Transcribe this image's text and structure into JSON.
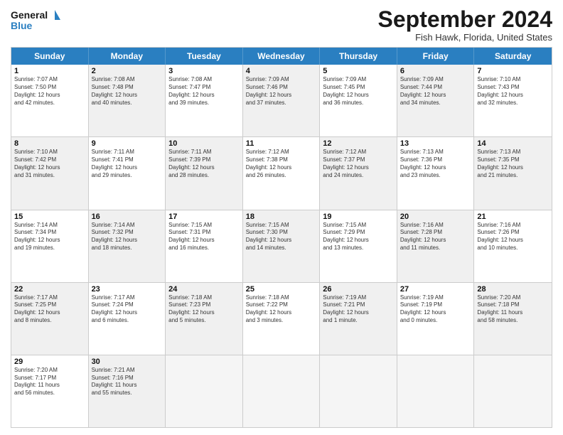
{
  "logo": {
    "line1": "General",
    "line2": "Blue"
  },
  "title": "September 2024",
  "location": "Fish Hawk, Florida, United States",
  "days": [
    "Sunday",
    "Monday",
    "Tuesday",
    "Wednesday",
    "Thursday",
    "Friday",
    "Saturday"
  ],
  "weeks": [
    [
      {
        "num": "1",
        "info": "Sunrise: 7:07 AM\nSunset: 7:50 PM\nDaylight: 12 hours\nand 42 minutes.",
        "shaded": false
      },
      {
        "num": "2",
        "info": "Sunrise: 7:08 AM\nSunset: 7:48 PM\nDaylight: 12 hours\nand 40 minutes.",
        "shaded": true
      },
      {
        "num": "3",
        "info": "Sunrise: 7:08 AM\nSunset: 7:47 PM\nDaylight: 12 hours\nand 39 minutes.",
        "shaded": false
      },
      {
        "num": "4",
        "info": "Sunrise: 7:09 AM\nSunset: 7:46 PM\nDaylight: 12 hours\nand 37 minutes.",
        "shaded": true
      },
      {
        "num": "5",
        "info": "Sunrise: 7:09 AM\nSunset: 7:45 PM\nDaylight: 12 hours\nand 36 minutes.",
        "shaded": false
      },
      {
        "num": "6",
        "info": "Sunrise: 7:09 AM\nSunset: 7:44 PM\nDaylight: 12 hours\nand 34 minutes.",
        "shaded": true
      },
      {
        "num": "7",
        "info": "Sunrise: 7:10 AM\nSunset: 7:43 PM\nDaylight: 12 hours\nand 32 minutes.",
        "shaded": false
      }
    ],
    [
      {
        "num": "8",
        "info": "Sunrise: 7:10 AM\nSunset: 7:42 PM\nDaylight: 12 hours\nand 31 minutes.",
        "shaded": true
      },
      {
        "num": "9",
        "info": "Sunrise: 7:11 AM\nSunset: 7:41 PM\nDaylight: 12 hours\nand 29 minutes.",
        "shaded": false
      },
      {
        "num": "10",
        "info": "Sunrise: 7:11 AM\nSunset: 7:39 PM\nDaylight: 12 hours\nand 28 minutes.",
        "shaded": true
      },
      {
        "num": "11",
        "info": "Sunrise: 7:12 AM\nSunset: 7:38 PM\nDaylight: 12 hours\nand 26 minutes.",
        "shaded": false
      },
      {
        "num": "12",
        "info": "Sunrise: 7:12 AM\nSunset: 7:37 PM\nDaylight: 12 hours\nand 24 minutes.",
        "shaded": true
      },
      {
        "num": "13",
        "info": "Sunrise: 7:13 AM\nSunset: 7:36 PM\nDaylight: 12 hours\nand 23 minutes.",
        "shaded": false
      },
      {
        "num": "14",
        "info": "Sunrise: 7:13 AM\nSunset: 7:35 PM\nDaylight: 12 hours\nand 21 minutes.",
        "shaded": true
      }
    ],
    [
      {
        "num": "15",
        "info": "Sunrise: 7:14 AM\nSunset: 7:34 PM\nDaylight: 12 hours\nand 19 minutes.",
        "shaded": false
      },
      {
        "num": "16",
        "info": "Sunrise: 7:14 AM\nSunset: 7:32 PM\nDaylight: 12 hours\nand 18 minutes.",
        "shaded": true
      },
      {
        "num": "17",
        "info": "Sunrise: 7:15 AM\nSunset: 7:31 PM\nDaylight: 12 hours\nand 16 minutes.",
        "shaded": false
      },
      {
        "num": "18",
        "info": "Sunrise: 7:15 AM\nSunset: 7:30 PM\nDaylight: 12 hours\nand 14 minutes.",
        "shaded": true
      },
      {
        "num": "19",
        "info": "Sunrise: 7:15 AM\nSunset: 7:29 PM\nDaylight: 12 hours\nand 13 minutes.",
        "shaded": false
      },
      {
        "num": "20",
        "info": "Sunrise: 7:16 AM\nSunset: 7:28 PM\nDaylight: 12 hours\nand 11 minutes.",
        "shaded": true
      },
      {
        "num": "21",
        "info": "Sunrise: 7:16 AM\nSunset: 7:26 PM\nDaylight: 12 hours\nand 10 minutes.",
        "shaded": false
      }
    ],
    [
      {
        "num": "22",
        "info": "Sunrise: 7:17 AM\nSunset: 7:25 PM\nDaylight: 12 hours\nand 8 minutes.",
        "shaded": true
      },
      {
        "num": "23",
        "info": "Sunrise: 7:17 AM\nSunset: 7:24 PM\nDaylight: 12 hours\nand 6 minutes.",
        "shaded": false
      },
      {
        "num": "24",
        "info": "Sunrise: 7:18 AM\nSunset: 7:23 PM\nDaylight: 12 hours\nand 5 minutes.",
        "shaded": true
      },
      {
        "num": "25",
        "info": "Sunrise: 7:18 AM\nSunset: 7:22 PM\nDaylight: 12 hours\nand 3 minutes.",
        "shaded": false
      },
      {
        "num": "26",
        "info": "Sunrise: 7:19 AM\nSunset: 7:21 PM\nDaylight: 12 hours\nand 1 minute.",
        "shaded": true
      },
      {
        "num": "27",
        "info": "Sunrise: 7:19 AM\nSunset: 7:19 PM\nDaylight: 12 hours\nand 0 minutes.",
        "shaded": false
      },
      {
        "num": "28",
        "info": "Sunrise: 7:20 AM\nSunset: 7:18 PM\nDaylight: 11 hours\nand 58 minutes.",
        "shaded": true
      }
    ],
    [
      {
        "num": "29",
        "info": "Sunrise: 7:20 AM\nSunset: 7:17 PM\nDaylight: 11 hours\nand 56 minutes.",
        "shaded": false
      },
      {
        "num": "30",
        "info": "Sunrise: 7:21 AM\nSunset: 7:16 PM\nDaylight: 11 hours\nand 55 minutes.",
        "shaded": true
      },
      {
        "num": "",
        "info": "",
        "shaded": false,
        "empty": true
      },
      {
        "num": "",
        "info": "",
        "shaded": false,
        "empty": true
      },
      {
        "num": "",
        "info": "",
        "shaded": false,
        "empty": true
      },
      {
        "num": "",
        "info": "",
        "shaded": false,
        "empty": true
      },
      {
        "num": "",
        "info": "",
        "shaded": false,
        "empty": true
      }
    ]
  ]
}
